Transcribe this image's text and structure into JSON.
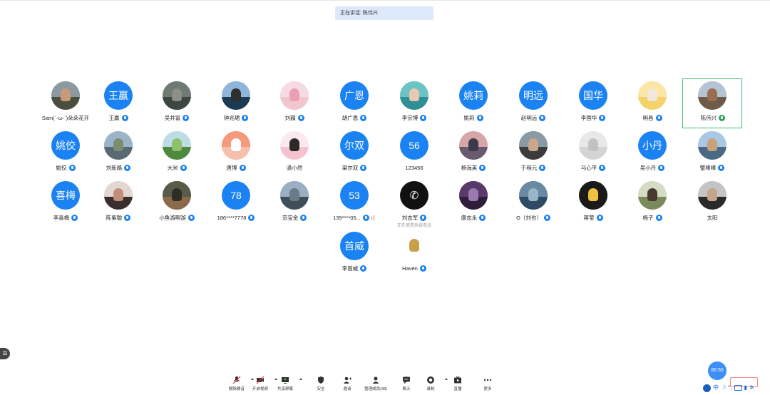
{
  "speaker_banner": "正在讲话: 陈伟兴",
  "participants": [
    {
      "name": "Sam(´-ω-`)朵朵花开",
      "avatar_type": "photo",
      "colors": [
        "#8a9aa0",
        "#4a4e3c",
        "#c89a78"
      ],
      "mic": "none"
    },
    {
      "name": "王赢",
      "avatar_type": "text",
      "avatar_text": "王赢",
      "mic": "on"
    },
    {
      "name": "吴井富",
      "avatar_type": "photo",
      "colors": [
        "#6f7a74",
        "#3e4640",
        "#8a8f88"
      ],
      "mic": "on"
    },
    {
      "name": "钟兆珺",
      "avatar_type": "photo",
      "colors": [
        "#8fb6d8",
        "#1d3a54",
        "#2e2e2e"
      ],
      "mic": "on"
    },
    {
      "name": "刘巍",
      "avatar_type": "photo",
      "colors": [
        "#f6dbe2",
        "#f2c6cf",
        "#e9a0b4"
      ],
      "mic": "on"
    },
    {
      "name": "胡广恩",
      "avatar_type": "text",
      "avatar_text": "广恩",
      "mic": "on"
    },
    {
      "name": "李宗博",
      "avatar_type": "photo",
      "colors": [
        "#6cc3c4",
        "#2f8e96",
        "#e8c9b0"
      ],
      "mic": "on"
    },
    {
      "name": "姚莉",
      "avatar_type": "text",
      "avatar_text": "姚莉",
      "mic": "on"
    },
    {
      "name": "赵明远",
      "avatar_type": "text",
      "avatar_text": "明远",
      "mic": "on"
    },
    {
      "name": "李国华",
      "avatar_type": "text",
      "avatar_text": "国华",
      "mic": "on"
    },
    {
      "name": "明昌",
      "avatar_type": "photo",
      "colors": [
        "#fbe6a6",
        "#f6d36a",
        "#f2e9dc"
      ],
      "mic": "on"
    },
    {
      "name": "陈伟兴",
      "avatar_type": "photo",
      "colors": [
        "#b4c4d2",
        "#6d5a48",
        "#9a6c52"
      ],
      "mic": "speaking"
    },
    {
      "name": "姚佼",
      "avatar_type": "text",
      "avatar_text": "姚佼",
      "mic": "on"
    },
    {
      "name": "刘新路",
      "avatar_type": "photo",
      "colors": [
        "#9bb4c8",
        "#5a6a72",
        "#7d8c6e"
      ],
      "mic": "on"
    },
    {
      "name": "大米",
      "avatar_type": "photo",
      "colors": [
        "#bcdce6",
        "#4e8a3c",
        "#8fc06a"
      ],
      "mic": "on"
    },
    {
      "name": "唐博",
      "avatar_type": "photo",
      "colors": [
        "#f59a7a",
        "#f6c0ad",
        "#ffffff"
      ],
      "mic": "on"
    },
    {
      "name": "潇小然",
      "avatar_type": "photo",
      "colors": [
        "#fbe9ee",
        "#f5c3d0",
        "#2a2a2a"
      ],
      "mic": "none"
    },
    {
      "name": "梁尔双",
      "avatar_type": "text",
      "avatar_text": "尔双",
      "mic": "on"
    },
    {
      "name": "123456",
      "avatar_type": "text",
      "avatar_text": "56",
      "mic": "none"
    },
    {
      "name": "杨海英",
      "avatar_type": "photo",
      "colors": [
        "#d6a6a8",
        "#6a5a70",
        "#3c3a4a"
      ],
      "mic": "on"
    },
    {
      "name": "于程元",
      "avatar_type": "photo",
      "colors": [
        "#8a9aa4",
        "#3c3c3c",
        "#c9a78a"
      ],
      "mic": "on"
    },
    {
      "name": "马心平",
      "avatar_type": "photo",
      "colors": [
        "#e8e8e8",
        "#d4d4d4",
        "#c2c2c2"
      ],
      "mic": "on"
    },
    {
      "name": "吴小丹",
      "avatar_type": "text",
      "avatar_text": "小丹",
      "mic": "on"
    },
    {
      "name": "蟹棒棒",
      "avatar_type": "photo",
      "colors": [
        "#a9c8e4",
        "#4a6a84",
        "#c7a27a"
      ],
      "mic": "on"
    },
    {
      "name": "李喜梅",
      "avatar_type": "text",
      "avatar_text": "喜梅",
      "mic": "on"
    },
    {
      "name": "陈紫聪",
      "avatar_type": "photo",
      "colors": [
        "#e4d6d0",
        "#3a2e2e",
        "#c08e7a"
      ],
      "mic": "on"
    },
    {
      "name": "小鱼游啊游",
      "avatar_type": "photo",
      "colors": [
        "#5a5a4a",
        "#8a6a4a",
        "#2e2e24"
      ],
      "mic": "on"
    },
    {
      "name": "186****7778",
      "avatar_type": "text",
      "avatar_text": "78",
      "mic": "on"
    },
    {
      "name": "范宝金",
      "avatar_type": "photo",
      "colors": [
        "#9aaec4",
        "#3e4e5a",
        "#6a7a86"
      ],
      "mic": "on"
    },
    {
      "name": "139****05...",
      "avatar_type": "text",
      "avatar_text": "53",
      "mic": "off"
    },
    {
      "name": "刘志军",
      "avatar_type": "phone",
      "colors": [
        "#111111",
        "#111111",
        "#ffffff"
      ],
      "mic": "on",
      "note": "正在使用系统电话"
    },
    {
      "name": "康志永",
      "avatar_type": "photo",
      "colors": [
        "#5a3a6a",
        "#2e1e3a",
        "#9a7ab0"
      ],
      "mic": "on"
    },
    {
      "name": "G（刘也）",
      "avatar_type": "photo",
      "colors": [
        "#6a8aa4",
        "#2e4a64",
        "#9ab4c8"
      ],
      "mic": "on"
    },
    {
      "name": "蒋莹",
      "avatar_type": "photo",
      "colors": [
        "#1a1a1a",
        "#1a1a1a",
        "#f0c040"
      ],
      "mic": "on"
    },
    {
      "name": "杨子",
      "avatar_type": "photo",
      "colors": [
        "#d4dcc4",
        "#7a8a5a",
        "#4a3a2e"
      ],
      "mic": "on"
    },
    {
      "name": "太阳",
      "avatar_type": "photo",
      "colors": [
        "#c4c4c4",
        "#2a2a2a",
        "#c4a48a"
      ],
      "mic": "none"
    },
    {
      "name": "李首威",
      "avatar_type": "text",
      "avatar_text": "首威",
      "mic": "on"
    },
    {
      "name": "Haven",
      "avatar_type": "photo",
      "colors": [
        "#ffffff",
        "#ffffff",
        "#c8a04a"
      ],
      "mic": "on"
    }
  ],
  "toolbar": [
    {
      "label": "解除静音",
      "icon": "mic-muted-icon",
      "caret": true
    },
    {
      "label": "开启视频",
      "icon": "video-off-icon",
      "caret": true
    },
    {
      "label": "共享屏幕",
      "icon": "share-screen-icon",
      "caret": true
    },
    {
      "label": "安全",
      "icon": "shield-icon",
      "caret": false
    },
    {
      "label": "邀请",
      "icon": "invite-icon",
      "caret": false
    },
    {
      "label": "管理成员(38)",
      "icon": "members-icon",
      "caret": false
    },
    {
      "label": "聊天",
      "icon": "chat-icon",
      "caret": false
    },
    {
      "label": "录制",
      "icon": "record-icon",
      "caret": true
    },
    {
      "label": "直播",
      "icon": "live-icon",
      "caret": false
    },
    {
      "label": "更多",
      "icon": "more-icon",
      "caret": false
    }
  ],
  "timer_badge": "86:55",
  "tray": {
    "ime_label": "中"
  },
  "accent_color": "#1a82f2",
  "speaker_highlight_color": "#3dbf6d"
}
